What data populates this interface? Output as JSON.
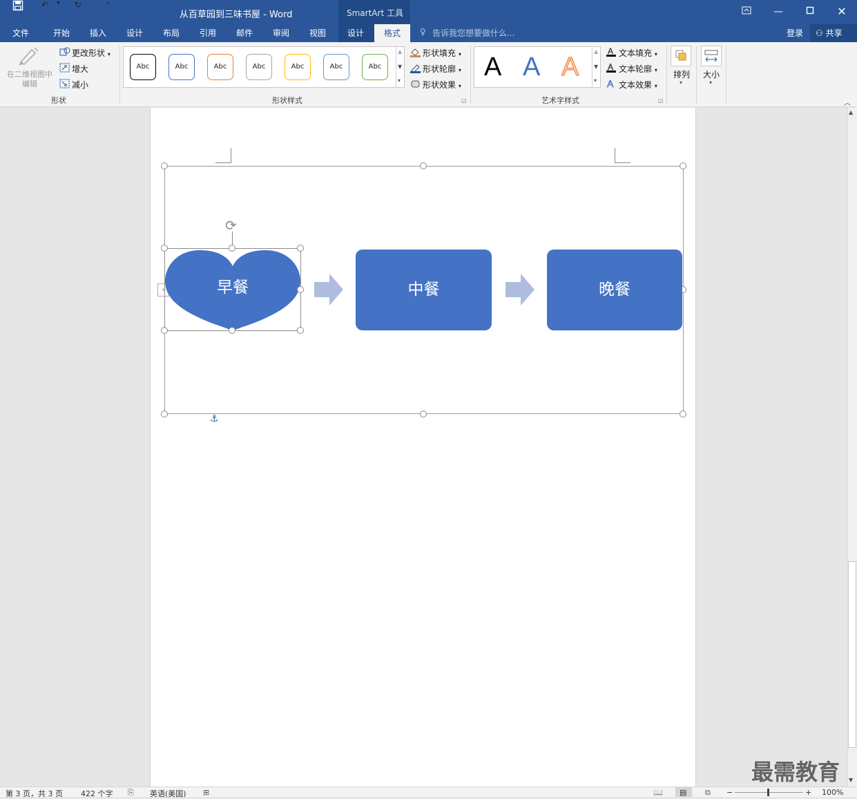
{
  "window": {
    "title": "从百草园到三味书屋 - Word",
    "context_label": "SmartArt 工具"
  },
  "tabs": [
    "文件",
    "开始",
    "插入",
    "设计",
    "布局",
    "引用",
    "邮件",
    "审阅",
    "视图",
    "设计",
    "格式"
  ],
  "active_tab": "格式",
  "tell_me": "告诉我您想要做什么...",
  "account": {
    "login": "登录",
    "share": "共享"
  },
  "ribbon": {
    "shapes_group": {
      "edit_2d": "在二维视图中\n编辑",
      "change_shape": "更改形状",
      "larger": "增大",
      "smaller": "减小",
      "label": "形状"
    },
    "shape_styles": {
      "preview_text": "Abc",
      "border_colors": [
        "#000000",
        "#4472c4",
        "#ed7d31",
        "#a5a5a5",
        "#ffc000",
        "#5b9bd5",
        "#70ad47"
      ],
      "fill": "形状填充",
      "outline": "形状轮廓",
      "effects": "形状效果",
      "label": "形状样式"
    },
    "wordart": {
      "letter": "A",
      "text_fill": "文本填充",
      "text_outline": "文本轮廓",
      "text_effects": "文本效果",
      "label": "艺术字样式"
    },
    "arrange": "排列",
    "size": "大小"
  },
  "smartart": {
    "fill_color": "#4472c4",
    "arrow_color": "#aebce0",
    "items": [
      "早餐",
      "中餐",
      "晚餐"
    ]
  },
  "status": {
    "page": "第 3 页，共 3 页",
    "words": "422 个字",
    "language": "英语(美国)",
    "zoom": "100%"
  },
  "watermark": "最需教育"
}
